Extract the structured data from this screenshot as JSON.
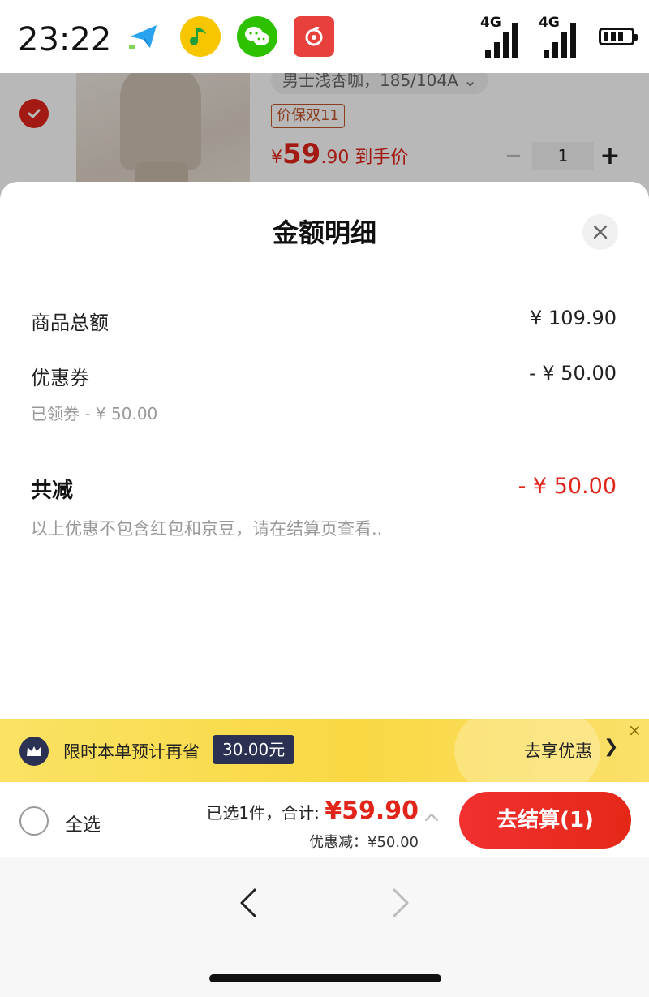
{
  "status_bar": {
    "time": "23:22",
    "network_1": "4G",
    "network_2": "4G",
    "app_icons": [
      "telegram-icon",
      "qq-music-icon",
      "wechat-icon",
      "netease-music-icon"
    ]
  },
  "background_product": {
    "variant": "男士浅杏咖，185/104A ⌄",
    "promo_tag": "价保双11",
    "price_symbol": "¥",
    "price_int": "59",
    "price_dec": ".90",
    "price_suffix": " 到手价",
    "quantity_minus": "−",
    "quantity": "1",
    "quantity_plus": "+"
  },
  "sheet": {
    "title": "金额明细",
    "rows": [
      {
        "label": "商品总额",
        "value": "¥ 109.90"
      },
      {
        "label": "优惠券",
        "value": "- ¥ 50.00",
        "sub": "已领券 - ¥ 50.00"
      }
    ],
    "total_label": "共减",
    "total_value": "- ¥ 50.00",
    "note": "以上优惠不包含红包和京豆，请在结算页查看.."
  },
  "banner": {
    "text": "限时本单预计再省",
    "badge": "30.00元",
    "action": "去享优惠",
    "chevron": "❯",
    "close": "×"
  },
  "checkout": {
    "select_all": "全选",
    "count_text": "已选1件，合计: ",
    "total": "¥59.90",
    "discount": "优惠减：¥50.00",
    "button": "去结算(1)"
  },
  "colors": {
    "accent_red": "#e1251b",
    "banner_yellow": "#f9d843",
    "badge_navy": "#2b3152"
  }
}
